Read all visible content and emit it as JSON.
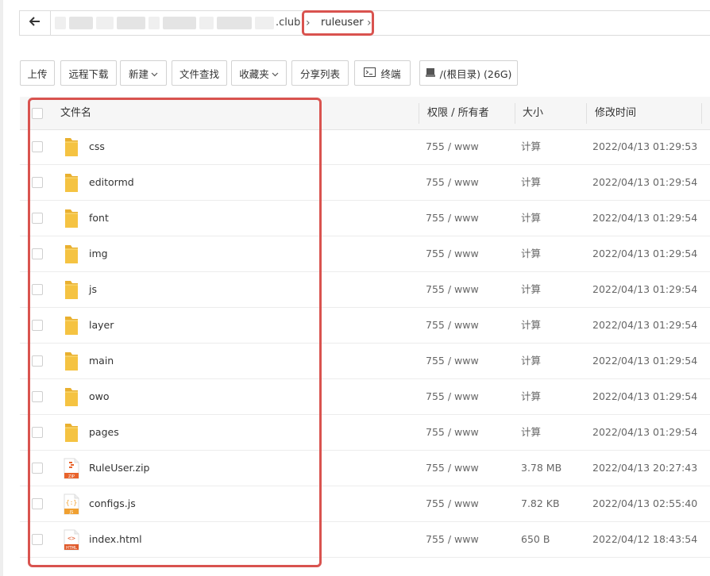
{
  "path": {
    "domain_suffix": ".club",
    "current_folder": "ruleuser"
  },
  "toolbar": {
    "upload": "上传",
    "remote_download": "远程下载",
    "new": "新建",
    "file_search": "文件查找",
    "favorites": "收藏夹",
    "share_list": "分享列表",
    "terminal": "终端",
    "disk": "/(根目录) (26G)"
  },
  "table": {
    "headers": {
      "name": "文件名",
      "permission": "权限 / 所有者",
      "size": "大小",
      "modified": "修改时间"
    },
    "rows": [
      {
        "name": "css",
        "type": "folder",
        "permission": "755 / www",
        "size": "计算",
        "modified": "2022/04/13 01:29:53"
      },
      {
        "name": "editormd",
        "type": "folder",
        "permission": "755 / www",
        "size": "计算",
        "modified": "2022/04/13 01:29:54"
      },
      {
        "name": "font",
        "type": "folder",
        "permission": "755 / www",
        "size": "计算",
        "modified": "2022/04/13 01:29:54"
      },
      {
        "name": "img",
        "type": "folder",
        "permission": "755 / www",
        "size": "计算",
        "modified": "2022/04/13 01:29:54"
      },
      {
        "name": "js",
        "type": "folder",
        "permission": "755 / www",
        "size": "计算",
        "modified": "2022/04/13 01:29:54"
      },
      {
        "name": "layer",
        "type": "folder",
        "permission": "755 / www",
        "size": "计算",
        "modified": "2022/04/13 01:29:54"
      },
      {
        "name": "main",
        "type": "folder",
        "permission": "755 / www",
        "size": "计算",
        "modified": "2022/04/13 01:29:54"
      },
      {
        "name": "owo",
        "type": "folder",
        "permission": "755 / www",
        "size": "计算",
        "modified": "2022/04/13 01:29:54"
      },
      {
        "name": "pages",
        "type": "folder",
        "permission": "755 / www",
        "size": "计算",
        "modified": "2022/04/13 01:29:54"
      },
      {
        "name": "RuleUser.zip",
        "type": "zip",
        "icon_label": "ZIP",
        "permission": "755 / www",
        "size": "3.78 MB",
        "modified": "2022/04/13 20:27:43"
      },
      {
        "name": "configs.js",
        "type": "js",
        "icon_label": "JS",
        "permission": "755 / www",
        "size": "7.82 KB",
        "modified": "2022/04/13 02:55:40"
      },
      {
        "name": "index.html",
        "type": "html",
        "icon_label": "HTML",
        "permission": "755 / www",
        "size": "650 B",
        "modified": "2022/04/12 18:43:54"
      }
    ]
  },
  "colors": {
    "highlight": "#d9534f",
    "calc_link": "#2e9b45",
    "folder": "#f5c342",
    "zip_icon": "#e8632b",
    "js_icon": "#f0a030",
    "html_icon": "#e05a2b"
  }
}
